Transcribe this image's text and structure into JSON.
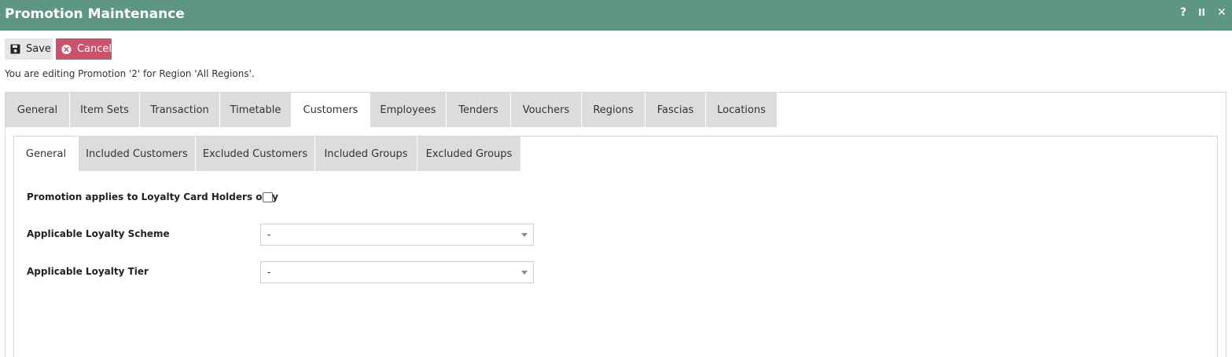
{
  "window": {
    "title": "Promotion Maintenance",
    "help_label": "?",
    "pause_label": "II",
    "close_label": "✕"
  },
  "toolbar": {
    "save_label": "Save",
    "save_icon": "floppy-disk-icon",
    "cancel_label": "Cancel",
    "cancel_icon": "circle-x-icon"
  },
  "info_text": "You are editing Promotion '2' for Region 'All Regions'.",
  "tabs": [
    {
      "label": "General"
    },
    {
      "label": "Item Sets"
    },
    {
      "label": "Transaction"
    },
    {
      "label": "Timetable"
    },
    {
      "label": "Customers",
      "active": true
    },
    {
      "label": "Employees"
    },
    {
      "label": "Tenders"
    },
    {
      "label": "Vouchers"
    },
    {
      "label": "Regions"
    },
    {
      "label": "Fascias"
    },
    {
      "label": "Locations"
    }
  ],
  "subtabs": [
    {
      "label": "General",
      "active": true
    },
    {
      "label": "Included Customers"
    },
    {
      "label": "Excluded Customers"
    },
    {
      "label": "Included Groups"
    },
    {
      "label": "Excluded Groups"
    }
  ],
  "form": {
    "loyalty_only_label": "Promotion applies to Loyalty Card Holders only",
    "loyalty_only_checked": false,
    "scheme_label": "Applicable Loyalty Scheme",
    "scheme_value": "-",
    "tier_label": "Applicable Loyalty Tier",
    "tier_value": "-"
  },
  "colors": {
    "titlebar": "#5e9686",
    "cancel": "#c9536a",
    "tab_inactive": "#dcdcdc"
  }
}
